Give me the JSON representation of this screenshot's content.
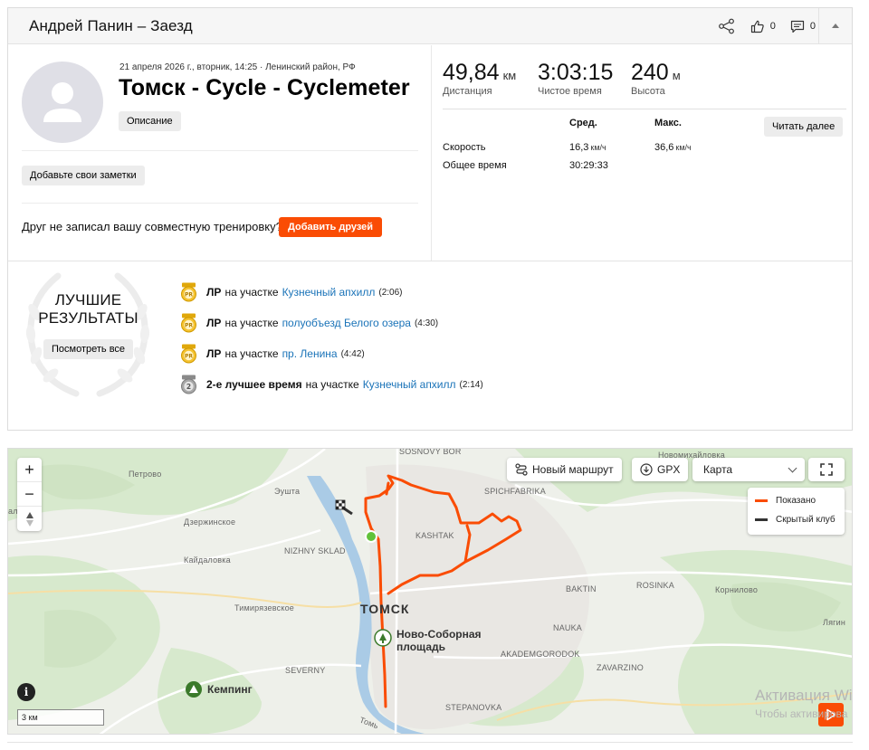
{
  "header": {
    "title": "Андрей Панин – Заезд",
    "likes_count": "0",
    "comments_count": "0"
  },
  "activity": {
    "meta": "21 апреля 2026 г., вторник, 14:25 · Ленинский район, РФ",
    "title": "Томск - Cycle - Cyclemeter",
    "description_btn": "Описание",
    "notes_btn": "Добавьте свои заметки",
    "friend_question": "Друг не записал вашу совместную тренировку?",
    "add_friends_btn": "Добавить друзей"
  },
  "stats": {
    "distance": {
      "value": "49,84",
      "unit": "км",
      "label": "Дистанция"
    },
    "moving_time": {
      "value": "3:03:15",
      "label": "Чистое время"
    },
    "elevation": {
      "value": "240",
      "unit": "м",
      "label": "Высота"
    },
    "col_avg": "Сред.",
    "col_max": "Макс.",
    "speed_label": "Скорость",
    "speed_avg": "16,3",
    "speed_max": "36,6",
    "speed_unit": "км/ч",
    "total_time_label": "Общее время",
    "total_time": "30:29:33",
    "read_more_btn": "Читать далее"
  },
  "best_results": {
    "title_line1": "ЛУЧШИЕ",
    "title_line2": "РЕЗУЛЬТАТЫ",
    "see_all_btn": "Посмотреть все",
    "on_segment": "на участке",
    "items": [
      {
        "badge": "PR",
        "label": "ЛР",
        "segment": "Кузнечный апхилл",
        "time": "(2:06)"
      },
      {
        "badge": "PR",
        "label": "ЛР",
        "segment": "полуобъезд Белого озера",
        "time": "(4:30)"
      },
      {
        "badge": "PR",
        "label": "ЛР",
        "segment": "пр. Ленина",
        "time": "(4:42)"
      },
      {
        "badge": "2",
        "label": "2-е лучшее время",
        "segment": "Кузнечный апхилл",
        "time": "(2:14)"
      }
    ]
  },
  "map": {
    "new_route_btn": "Новый маршрут",
    "gpx_btn": "GPX",
    "layer_select": "Карта",
    "legend_shown": "Показано",
    "legend_hidden": "Скрытый клуб",
    "scale": "3 км",
    "city": "ТОМСК",
    "poi_square": "Ново-Соборная площадь",
    "poi_camping": "Кемпинг",
    "labels": {
      "sosnovy_bor": "SOSNOVY BOR",
      "novomikh": "Новомихайловка",
      "petrovo": "Петрово",
      "eushta": "Эушта",
      "altsevo": "альцево",
      "dzerzh": "Дзержинское",
      "spichfabrika": "SPICHFABRIKA",
      "kashtak": "KASHTAK",
      "nizhny": "NIZHNY SKLAD",
      "kaidalovka": "Кайдаловка",
      "timiryaz": "Тимирязевское",
      "baktin": "BAKTIN",
      "rosinka": "ROSINKA",
      "kornilovo": "Корнилово",
      "nauka": "NAUKA",
      "akadem": "AKADEMGORODOK",
      "zavarzino": "ZAVARZINO",
      "lyagin": "Лягин",
      "severny": "SEVERNY",
      "stepanovka": "STEPANOVKA",
      "tom": "Томь"
    },
    "colors": {
      "route": "#fa4c04",
      "hidden": "#333333",
      "start": "#61c23a"
    }
  },
  "watermark": {
    "line1": "Активация Wi",
    "line2": "Чтобы активирова"
  }
}
